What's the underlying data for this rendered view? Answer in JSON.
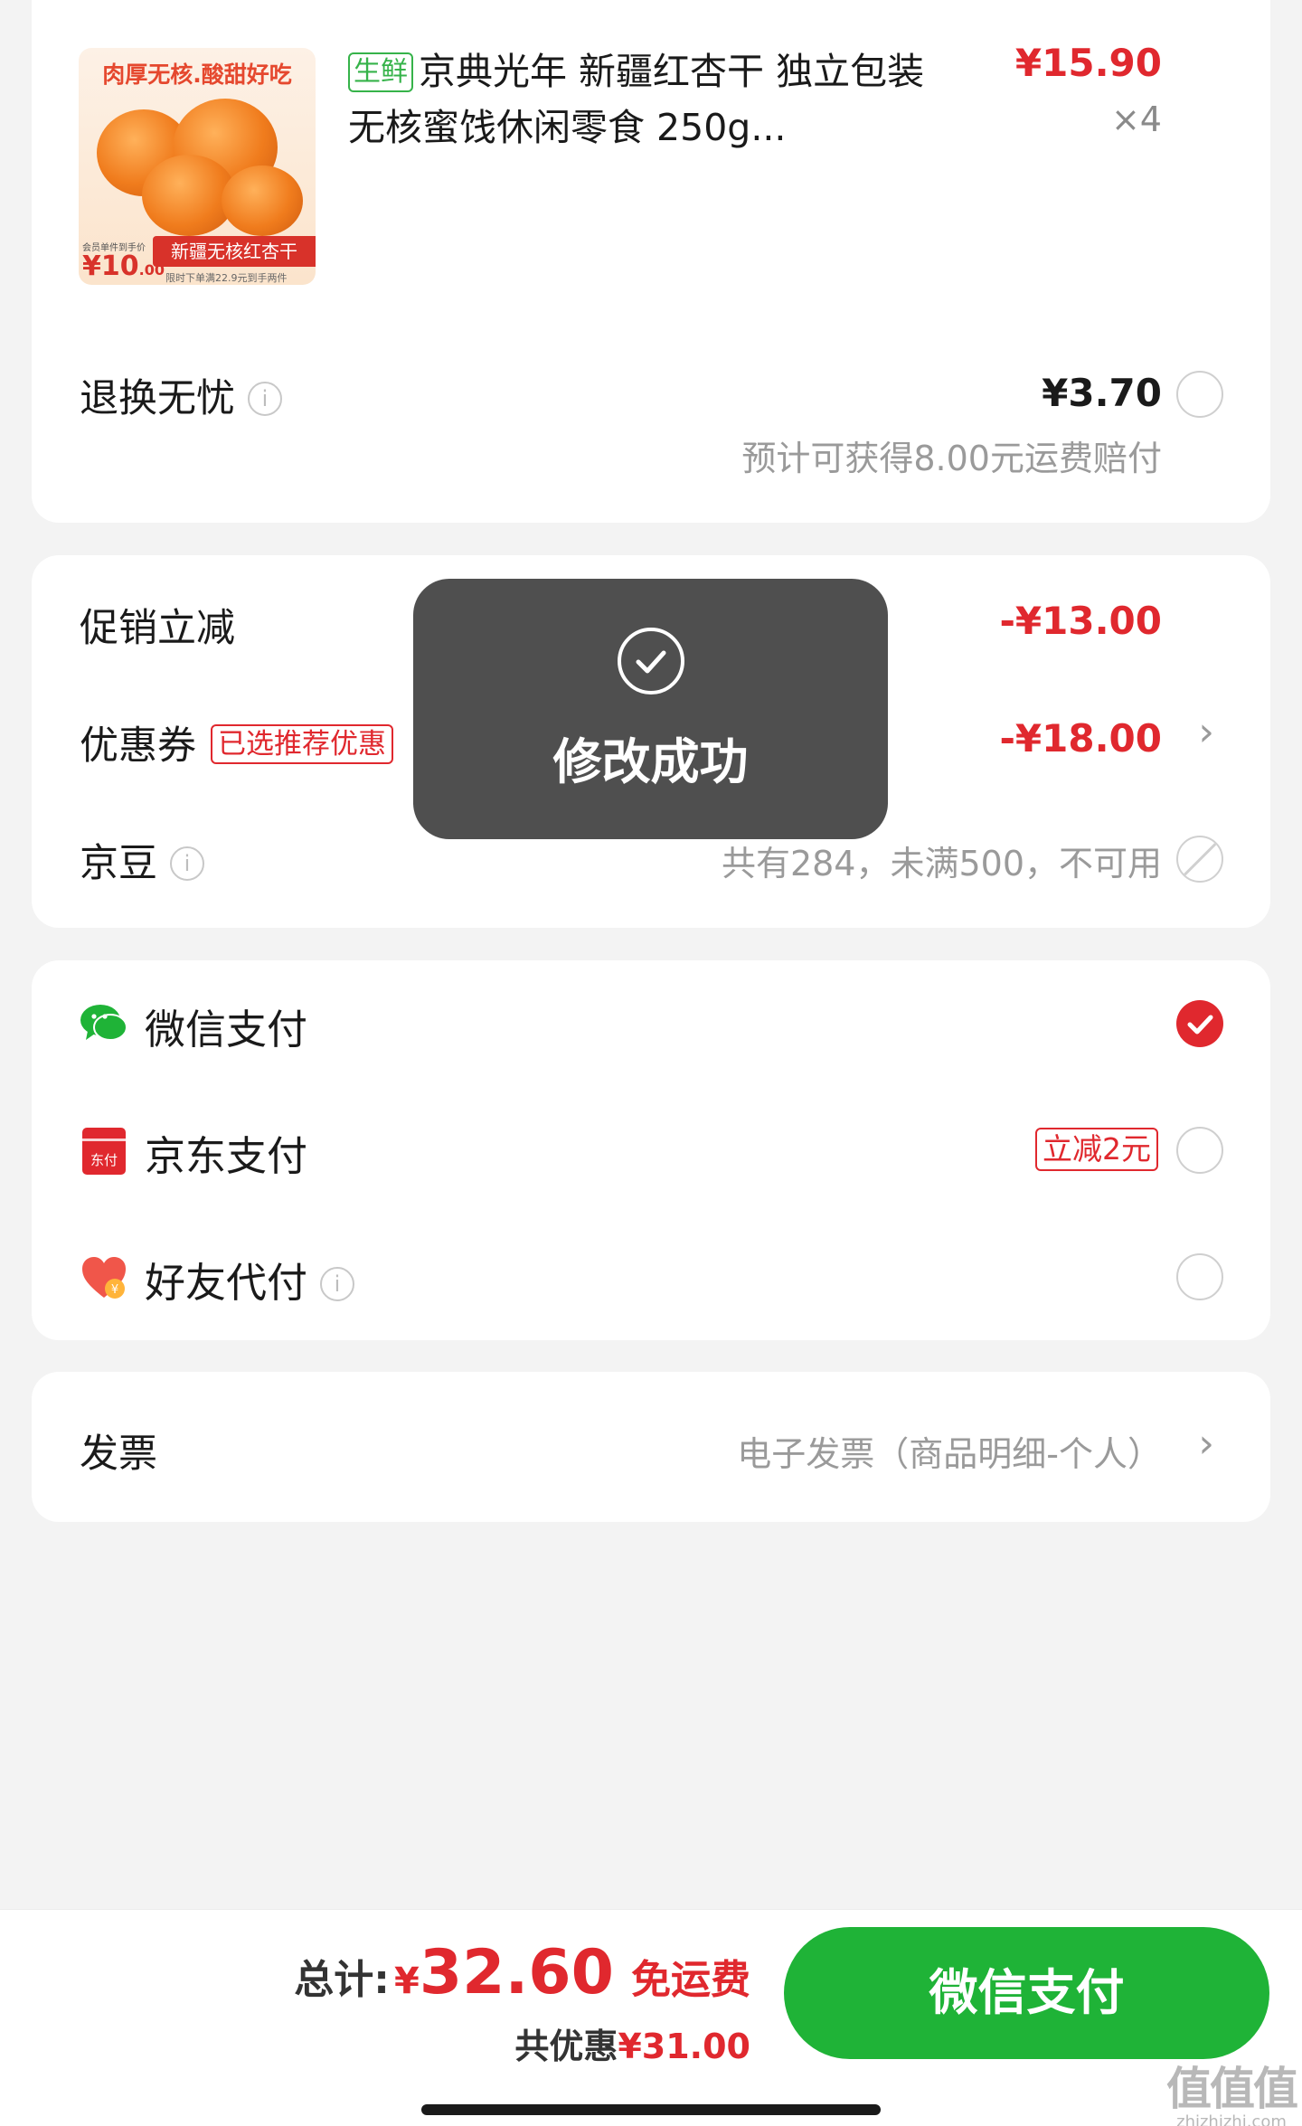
{
  "product": {
    "image": {
      "slogan": "肉厚无核.酸甜好吃",
      "ribbon": "新疆无核红杏干",
      "ribbon_sub": "限时下单满22.9元到手两件",
      "member_text": "会员单件到手价",
      "price_major": "¥10",
      "price_minor": ".00"
    },
    "tag": "生鲜",
    "title": "京典光年 新疆红杏干 独立包装 无核蜜饯休闲零食 250g...",
    "price": "¥15.90",
    "quantity": "×4"
  },
  "return_insurance": {
    "label": "退换无忧",
    "price": "¥3.70",
    "note": "预计可获得8.00元运费赔付"
  },
  "discounts": {
    "promo_label": "促销立减",
    "promo_value": "-¥13.00",
    "coupon_label": "优惠券",
    "coupon_tag": "已选推荐优惠",
    "coupon_value": "-¥18.00",
    "beans_label": "京豆",
    "beans_note": "共有284，未满500，不可用"
  },
  "toast": {
    "message": "修改成功"
  },
  "payment": {
    "wechat_label": "微信支付",
    "jd_label": "京东支付",
    "jd_icon_text": "东付",
    "jd_promo": "立减2元",
    "friend_label": "好友代付",
    "selected": "wechat"
  },
  "invoice": {
    "label": "发票",
    "value": "电子发票（商品明细-个人）"
  },
  "footer": {
    "total_label": "总计:",
    "currency": "¥",
    "total": "32.60",
    "shipping": "免运费",
    "saved_label": "共优惠",
    "saved": "¥31.00",
    "pay_button": "微信支付"
  },
  "watermark": {
    "big": "值值值",
    "small": "zhizhizhi.com"
  },
  "colors": {
    "accent_red": "#e0282e",
    "wechat_green": "#1fb337",
    "fresh_green": "#36b34a"
  }
}
